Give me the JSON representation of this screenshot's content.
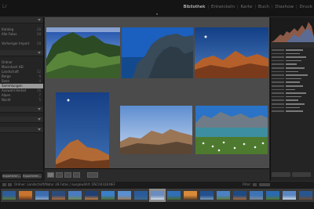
{
  "app": {
    "logo": "Lr",
    "modules": [
      "Bibliothek",
      "Entwickeln",
      "Karte",
      "Buch",
      "Diashow",
      "Druck"
    ],
    "active_module": "Bibliothek"
  },
  "left_panel": {
    "rows_a": [
      {
        "label": "Katalog",
        "count": "28"
      },
      {
        "label": "Alle Fotos",
        "count": "28"
      },
      {
        "label": "",
        "count": ""
      },
      {
        "label": "Vorheriger Import",
        "count": "28"
      }
    ],
    "rows_b": [
      {
        "label": "Ordner",
        "count": ""
      },
      {
        "label": "Macintosh HD",
        "count": ""
      },
      {
        "label": "Landschaft",
        "count": "12"
      },
      {
        "label": "Berge",
        "count": "9"
      },
      {
        "label": "Seen",
        "count": "4"
      },
      {
        "label": "Sammlungen",
        "count": ""
      },
      {
        "label": "Auswahl Herbst",
        "count": "16"
      },
      {
        "label": "Alpen",
        "count": "7"
      },
      {
        "label": "Nacht",
        "count": "5"
      }
    ],
    "selected_index": 5,
    "buttons": [
      "Importieren...",
      "Exportieren..."
    ]
  },
  "grid": {
    "photos": [
      "kauai-coast",
      "napali-cliffs",
      "desert-mesa-dusk",
      "moon-over-peak",
      "mountain-ridge",
      "alpine-meadow-lake"
    ]
  },
  "filmstrip": {
    "path": "Ordner: Landschaft/Natur 28 Fotos / ausgewählt: DSC04328.NEF",
    "filter_label": "Filter:",
    "thumb_count": 19,
    "selected_thumb": 9
  },
  "colors": {
    "accent": "#e6e6e6",
    "panel": "#242424",
    "grid_bg": "#4b4b4b"
  }
}
